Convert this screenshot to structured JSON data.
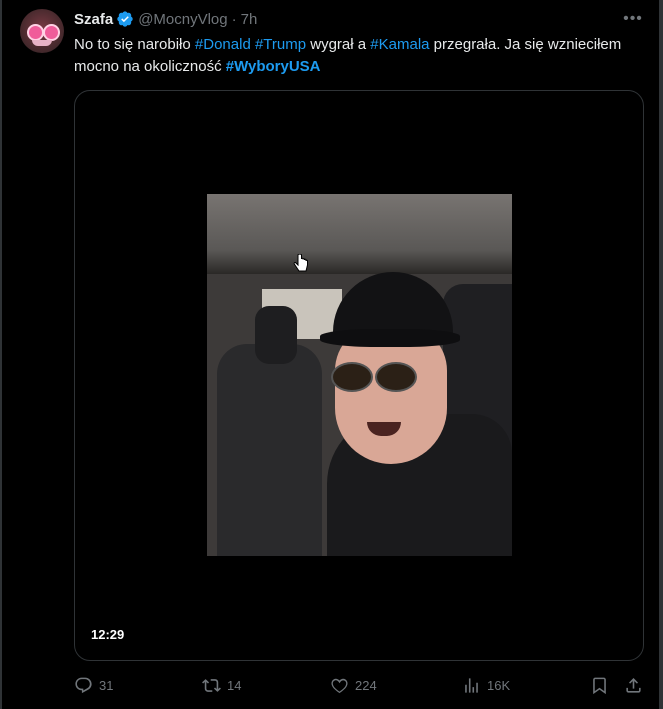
{
  "tweet": {
    "author_name": "Szafa",
    "handle": "@MocnyVlog",
    "separator": "·",
    "time": "7h",
    "text": {
      "t1": "No to się narobiło ",
      "h1": "#Donald",
      "t2": " ",
      "h2": "#Trump",
      "t3": " wygrał a ",
      "h3": "#Kamala",
      "t4": " przegrała. Ja się wznieciłem mocno na okoliczność ",
      "h4": "#WyboryUSA"
    },
    "video": {
      "duration": "12:29"
    },
    "actions": {
      "replies": "31",
      "reposts": "14",
      "likes": "224",
      "views": "16K"
    }
  },
  "colors": {
    "background": "#000000",
    "text": "#e7e9ea",
    "muted": "#71767b",
    "accent": "#1d9bf0",
    "border": "#2f3336"
  },
  "icons": {
    "verified": "verified-badge-icon",
    "more": "more-icon",
    "reply": "reply-icon",
    "repost": "repost-icon",
    "like": "like-icon",
    "views": "views-icon",
    "bookmark": "bookmark-icon",
    "share": "share-icon"
  }
}
